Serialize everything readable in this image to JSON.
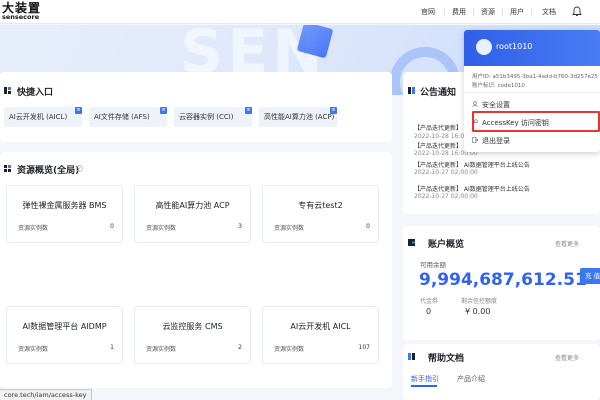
{
  "brand": {
    "name_cn": "大装置",
    "name_en": "sensecore"
  },
  "topnav": [
    "官网",
    "费用",
    "资源",
    "用户",
    "文档"
  ],
  "hero": {
    "watermark": "SEN"
  },
  "quick_entry": {
    "title": "快捷入口",
    "items": [
      "AI云开发机 (AICL)",
      "AI文件存储 (AFS)",
      "云容器实例 (CCI)",
      "高性能AI算力池 (ACP)"
    ]
  },
  "resources": {
    "title": "资源概览(全局)",
    "count_label": "资源实例数",
    "items": [
      {
        "name": "弹性裸金属服务器 BMS",
        "count": "0"
      },
      {
        "name": "高性能AI算力池 ACP",
        "count": "3"
      },
      {
        "name": "专有云test2",
        "count": "0"
      },
      {
        "name": "AI数据管理平台 AIDMP",
        "count": "1"
      },
      {
        "name": "云监控服务 CMS",
        "count": "2"
      },
      {
        "name": "AI云开发机 AICL",
        "count": "107"
      }
    ]
  },
  "announcements": {
    "title": "公告通知",
    "items": [
      {
        "text": "【产品迭代更新】",
        "date": "2022-10-28 16:0"
      },
      {
        "text": "【产品迭代更新】",
        "date": "2022-10-28 16:00:00"
      },
      {
        "text": "【产品迭代更新】 AI数据管理平台上线公告",
        "date": "2022-10-27 02:00:00"
      },
      {
        "text": "【产品迭代更新】 AI数据管理平台上线公告",
        "date": "2022-10-27 02:00:00"
      }
    ]
  },
  "account": {
    "title": "账户概览",
    "more": "查看更多",
    "balance_label": "可用余额",
    "balance": "9,994,687,612.51",
    "recharge": "充 值",
    "voucher_label": "代金券",
    "voucher_value": "0",
    "credit_label": "剩余信控额度",
    "credit_value": "¥ 0.00"
  },
  "help": {
    "title": "帮助文档",
    "more": "查看更多",
    "tabs": [
      "新手指引",
      "产品介绍"
    ]
  },
  "user_menu": {
    "username": "root1010",
    "user_id": "用户ID: a51b3495-3ba1-4add-b760-3d257e25",
    "user_identity": "账户标识: code1010",
    "items": [
      "安全设置",
      "AccessKey 访问密钥",
      "退出登录"
    ]
  },
  "status_url": "core.tech/iam/access-key",
  "colors": {
    "accent": "#3b78f0",
    "balance": "#2f62f5",
    "highlight": "#e5372f"
  }
}
